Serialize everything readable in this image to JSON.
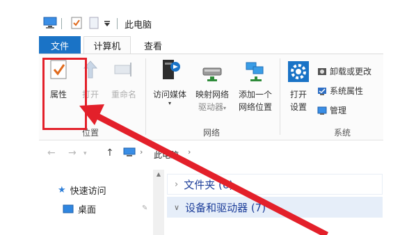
{
  "window": {
    "title": "此电脑"
  },
  "tabs": [
    {
      "label": "文件"
    },
    {
      "label": "计算机"
    },
    {
      "label": "查看"
    }
  ],
  "ribbon": {
    "location_group": {
      "label": "位置",
      "buttons": [
        {
          "label": "属性",
          "icon": "properties-check-icon"
        },
        {
          "label": "打开",
          "icon": "open-arrow-icon"
        },
        {
          "label": "重命名",
          "icon": "rename-icon"
        }
      ]
    },
    "network_group": {
      "label": "网络",
      "buttons": [
        {
          "line1": "访问媒体",
          "icon": "media-icon"
        },
        {
          "line1": "映射网络",
          "line2": "驱动器",
          "icon": "map-drive-icon"
        },
        {
          "line1": "添加一个",
          "line2": "网络位置",
          "icon": "network-location-icon"
        }
      ]
    },
    "system_group": {
      "label": "系统",
      "open_settings": {
        "line1": "打开",
        "line2": "设置",
        "icon": "gear-icon"
      },
      "items": [
        {
          "label": "卸载或更改",
          "icon": "uninstall-icon"
        },
        {
          "label": "系统属性",
          "icon": "system-properties-icon"
        },
        {
          "label": "管理",
          "icon": "manage-icon"
        }
      ]
    }
  },
  "nav": {
    "breadcrumb": "此电脑"
  },
  "sidebar": {
    "items": [
      {
        "label": "快速访问",
        "icon": "star-icon"
      },
      {
        "label": "桌面",
        "icon": "desktop-icon"
      }
    ]
  },
  "content": {
    "sections": [
      {
        "label": "文件夹 (6)"
      },
      {
        "label": "设备和驱动器 (7)"
      }
    ]
  },
  "colors": {
    "file_tab": "#1a73c6",
    "highlight": "#e3202a",
    "section_text": "#1e3f9a"
  }
}
